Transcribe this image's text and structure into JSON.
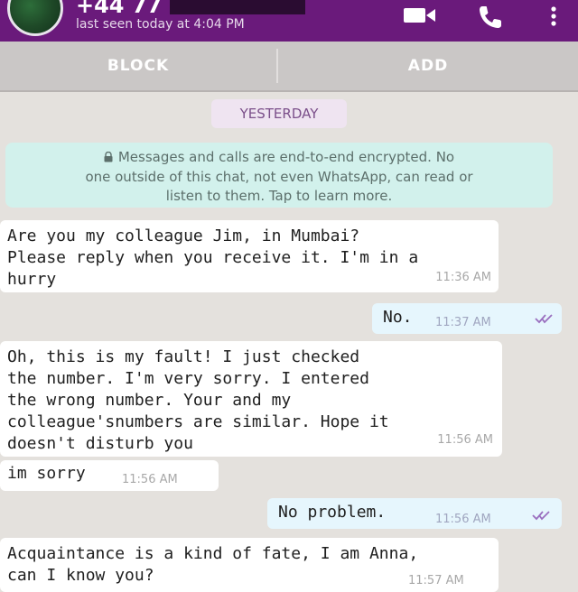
{
  "header": {
    "contact_name": "+44 77",
    "last_seen": "last seen today at 4:04 PM",
    "icons": [
      "video-call-icon",
      "voice-call-icon",
      "more-options-icon"
    ],
    "color": "#6a1a7b"
  },
  "actions": {
    "block_label": "BLOCK",
    "add_label": "ADD"
  },
  "date_chip": "YESTERDAY",
  "encryption_notice": {
    "line1": "Messages and calls are end-to-end encrypted. No",
    "line2": "one outside of this chat, not even WhatsApp, can read or",
    "line3": "listen to them. Tap to learn more."
  },
  "messages": [
    {
      "direction": "in",
      "lines": [
        "Are you my colleague Jim, in Mumbai?",
        "Please reply when you receive it. I'm in a",
        "hurry"
      ],
      "time": "11:36 AM"
    },
    {
      "direction": "out",
      "lines": [
        "No."
      ],
      "time": "11:37 AM",
      "status": "read"
    },
    {
      "direction": "in",
      "lines": [
        "Oh, this is my fault! I just checked",
        "the number. I'm very sorry. I entered",
        "the wrong number. Your and my",
        "colleague'snumbers are similar. Hope it",
        "doesn't disturb you"
      ],
      "time": "11:56 AM"
    },
    {
      "direction": "in",
      "lines": [
        "im sorry"
      ],
      "time": "11:56 AM"
    },
    {
      "direction": "out",
      "lines": [
        "No problem."
      ],
      "time": "11:56 AM",
      "status": "read"
    },
    {
      "direction": "in",
      "lines": [
        "Acquaintance is a kind of fate, I am Anna,",
        "can I know you?"
      ],
      "time": "11:57 AM"
    }
  ],
  "colors": {
    "background": "#e4e1dd",
    "incoming": "#ffffff",
    "outgoing": "#e6f6fd",
    "read_ticks": "#9a6fbf"
  }
}
